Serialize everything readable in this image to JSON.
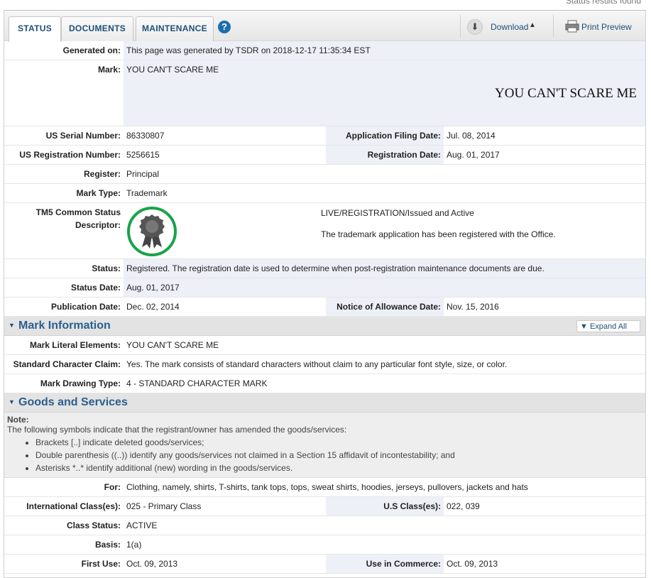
{
  "top_note": "Status results found",
  "tabs": [
    {
      "label": "STATUS",
      "active": true
    },
    {
      "label": "DOCUMENTS",
      "active": false
    },
    {
      "label": "MAINTENANCE",
      "active": false
    }
  ],
  "help_icon": "?",
  "toolbar": {
    "download_label": "Download",
    "download_icon": "download-arrow-icon",
    "print_label": "Print Preview",
    "print_icon": "printer-icon"
  },
  "status": {
    "generated_on_label": "Generated on:",
    "generated_on": "This page was generated by TSDR on 2018-12-17 11:35:34 EST",
    "mark_label": "Mark:",
    "mark": "YOU CAN'T SCARE ME",
    "mark_image_text": "YOU CAN'T SCARE ME",
    "serial_label": "US Serial Number:",
    "serial": "86330807",
    "filing_date_label": "Application Filing Date:",
    "filing_date": "Jul. 08, 2014",
    "reg_number_label": "US Registration Number:",
    "reg_number": "5256615",
    "reg_date_label": "Registration Date:",
    "reg_date": "Aug. 01, 2017",
    "register_label": "Register:",
    "register": "Principal",
    "mark_type_label": "Mark Type:",
    "mark_type": "Trademark",
    "tm5_label_line1": "TM5 Common Status",
    "tm5_label_line2": "Descriptor:",
    "tm5_status": "LIVE/REGISTRATION/Issued and Active",
    "tm5_desc": "The trademark application has been registered with the Office.",
    "status_label": "Status:",
    "status_text": "Registered. The registration date is used to determine when post-registration maintenance documents are due.",
    "status_date_label": "Status Date:",
    "status_date": "Aug. 01, 2017",
    "pub_date_label": "Publication Date:",
    "pub_date": "Dec. 02, 2014",
    "allowance_label": "Notice of Allowance Date:",
    "allowance_date": "Nov. 15, 2016"
  },
  "mark_info": {
    "title": "Mark Information",
    "expand_all": "Expand All",
    "literal_label": "Mark Literal Elements:",
    "literal": "YOU CAN'T SCARE ME",
    "std_char_label": "Standard Character Claim:",
    "std_char": "Yes. The mark consists of standard characters without claim to any particular font style, size, or color.",
    "drawing_label": "Mark Drawing Type:",
    "drawing": "4 - STANDARD CHARACTER MARK"
  },
  "goods": {
    "title": "Goods and Services",
    "note_title": "Note:",
    "note_intro": "The following symbols indicate that the registrant/owner has amended the goods/services:",
    "note_items": [
      "Brackets [..] indicate deleted goods/services;",
      "Double parenthesis ((..)) identify any goods/services not claimed in a Section 15 affidavit of incontestability; and",
      "Asterisks *..* identify additional (new) wording in the goods/services."
    ],
    "for_label": "For:",
    "for_text": "Clothing, namely, shirts, T-shirts, tank tops, tops, sweat shirts, hoodies, jerseys, pullovers, jackets and hats",
    "intl_label": "International Class(es):",
    "intl": "025 - Primary Class",
    "us_class_label": "U.S Class(es):",
    "us_class": "022, 039",
    "class_status_label": "Class Status:",
    "class_status": "ACTIVE",
    "basis_label": "Basis:",
    "basis": "1(a)",
    "first_use_label": "First Use:",
    "first_use": "Oct. 09, 2013",
    "commerce_label": "Use in Commerce:",
    "commerce": "Oct. 09, 2013"
  },
  "colors": {
    "accent": "#1f4f7a",
    "label_bg": "#eef0f8",
    "badge_green": "#1aa34a"
  }
}
